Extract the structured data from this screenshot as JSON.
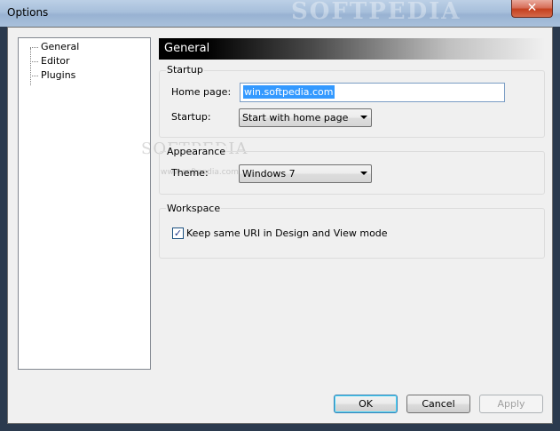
{
  "window": {
    "title": "Options",
    "watermark": "SOFTPEDIA",
    "close_symbol": "✕"
  },
  "tree": {
    "items": [
      {
        "label": "General"
      },
      {
        "label": "Editor"
      },
      {
        "label": "Plugins"
      }
    ]
  },
  "section": {
    "title": "General"
  },
  "startup": {
    "group_label": "Startup",
    "home_page_label": "Home page:",
    "home_page_value": "win.softpedia.com",
    "startup_label": "Startup:",
    "startup_value": "Start with home page"
  },
  "appearance": {
    "group_label": "Appearance",
    "theme_label": "Theme:",
    "theme_value": "Windows 7",
    "watermark": "SOFTPEDIA",
    "watermark_small": "www.softpedia.com"
  },
  "workspace": {
    "group_label": "Workspace",
    "keep_uri_label": "Keep same URI in Design and View mode",
    "keep_uri_checked": true,
    "check_mark": "✓"
  },
  "buttons": {
    "ok": "OK",
    "cancel": "Cancel",
    "apply": "Apply"
  },
  "colors": {
    "selection": "#3399ff",
    "textbox_border": "#7a9cc4",
    "close_button": "#c4401f"
  }
}
